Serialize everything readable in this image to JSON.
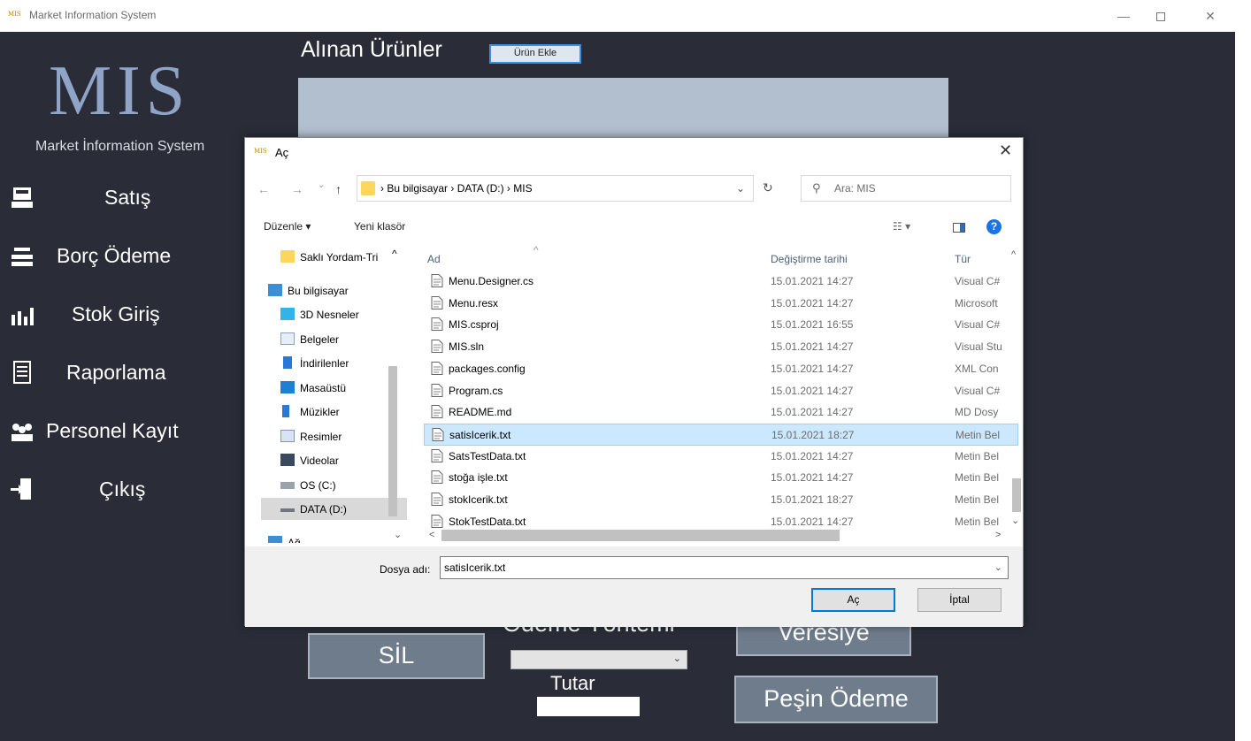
{
  "window": {
    "app_icon_text": "MIS",
    "title": "Market Information System",
    "min_glyph": "—",
    "close_glyph": "✕"
  },
  "sidebar": {
    "logo": "MIS",
    "subtitle": "Market İnformation System",
    "items": [
      {
        "label": "Satış",
        "icon": "cash-register-icon"
      },
      {
        "label": "Borç Ödeme",
        "icon": "payment-icon"
      },
      {
        "label": "Stok Giriş",
        "icon": "stock-chart-icon"
      },
      {
        "label": "Raporlama",
        "icon": "report-icon"
      },
      {
        "label": "Personel Kayıt",
        "icon": "people-icon"
      },
      {
        "label": "Çıkış",
        "icon": "exit-door-icon"
      }
    ]
  },
  "main": {
    "section_title": "Alınan Ürünler",
    "add_button": "Ürün Ekle",
    "delete_button": "SİL",
    "payment_method_label": "Ödeme Yöntemi",
    "credit_button": "Veresiye",
    "total_label": "Tutar",
    "cash_button": "Peşin Ödeme"
  },
  "dialog": {
    "icon_text": "MIS",
    "title": "Aç",
    "close_glyph": "✕",
    "back_glyph": "←",
    "forward_glyph": "→",
    "recent_glyph": "⌄",
    "up_glyph": "↑",
    "breadcrumb": "›  Bu bilgisayar  ›  DATA (D:)  ›  MIS",
    "address_dropdown_glyph": "⌄",
    "refresh_glyph": "↻",
    "search_glyph": "⚲",
    "search_placeholder": "Ara: MIS",
    "organize": "Düzenle ▾",
    "new_folder": "Yeni klasör",
    "view_glyph": "☷ ▾",
    "help_glyph": "?",
    "nav": [
      {
        "label": "Saklı Yordam-Tri",
        "icon": "folder-icon"
      },
      {
        "label": "Bu bilgisayar",
        "icon": "computer-icon"
      },
      {
        "label": "3D Nesneler",
        "icon": "cube-icon"
      },
      {
        "label": "Belgeler",
        "icon": "documents-icon"
      },
      {
        "label": "İndirilenler",
        "icon": "download-icon"
      },
      {
        "label": "Masaüstü",
        "icon": "desktop-icon"
      },
      {
        "label": "Müzikler",
        "icon": "music-icon"
      },
      {
        "label": "Resimler",
        "icon": "pictures-icon"
      },
      {
        "label": "Videolar",
        "icon": "video-icon"
      },
      {
        "label": "OS (C:)",
        "icon": "drive-icon"
      },
      {
        "label": "DATA (D:)",
        "icon": "drive-icon"
      },
      {
        "label": "Ağ",
        "icon": "network-icon"
      }
    ],
    "columns": {
      "name": "Ad",
      "date": "Değiştirme tarihi",
      "type": "Tür"
    },
    "sort_glyph": "^",
    "files": [
      {
        "name": "Menu.Designer.cs",
        "date": "15.01.2021 14:27",
        "type": "Visual C#"
      },
      {
        "name": "Menu.resx",
        "date": "15.01.2021 14:27",
        "type": "Microsoft"
      },
      {
        "name": "MIS.csproj",
        "date": "15.01.2021 16:55",
        "type": "Visual C#"
      },
      {
        "name": "MIS.sln",
        "date": "15.01.2021 14:27",
        "type": "Visual Stu"
      },
      {
        "name": "packages.config",
        "date": "15.01.2021 14:27",
        "type": "XML Con"
      },
      {
        "name": "Program.cs",
        "date": "15.01.2021 14:27",
        "type": "Visual C#"
      },
      {
        "name": "README.md",
        "date": "15.01.2021 14:27",
        "type": "MD Dosy"
      },
      {
        "name": "satisIcerik.txt",
        "date": "15.01.2021 18:27",
        "type": "Metin Bel"
      },
      {
        "name": "SatsTestData.txt",
        "date": "15.01.2021 14:27",
        "type": "Metin Bel"
      },
      {
        "name": "stoğa işle.txt",
        "date": "15.01.2021 14:27",
        "type": "Metin Bel"
      },
      {
        "name": "stokIcerik.txt",
        "date": "15.01.2021 18:27",
        "type": "Metin Bel"
      },
      {
        "name": "StokTestData.txt",
        "date": "15.01.2021 14:27",
        "type": "Metin Bel"
      }
    ],
    "scroll_up": "^",
    "scroll_down": "⌄",
    "scroll_left": "<",
    "scroll_right": ">",
    "filename_label": "Dosya adı:",
    "filename_value": "satisIcerik.txt",
    "filename_dropdown_glyph": "⌄",
    "open_button": "Aç",
    "cancel_button": "İptal"
  }
}
